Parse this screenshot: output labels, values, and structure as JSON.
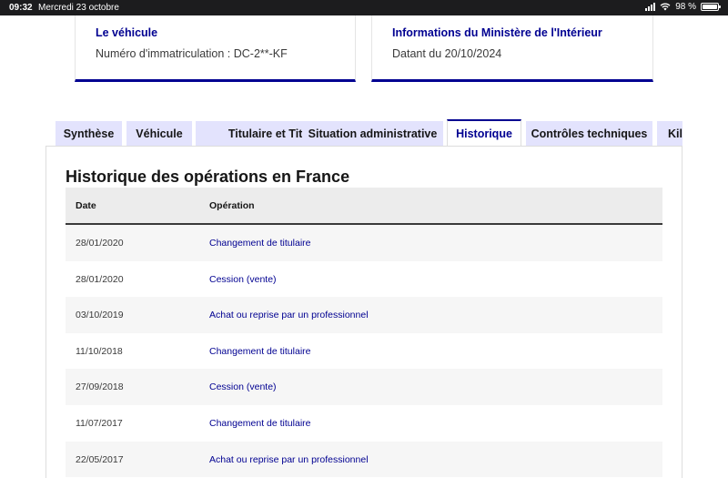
{
  "statusbar": {
    "time": "09:32",
    "date": "Mercredi 23 octobre",
    "battery": "98 %",
    "battery_level_percent": 98
  },
  "cards": {
    "vehicle": {
      "title": "Le véhicule",
      "text": "Numéro d'immatriculation : DC-2**-KF"
    },
    "ministry": {
      "title": "Informations du Ministère de l'Intérieur",
      "text": "Datant du 20/10/2024"
    }
  },
  "tabs": [
    {
      "label": "Synthèse"
    },
    {
      "label": "Véhicule"
    },
    {
      "label": "Titulaire et Titre"
    },
    {
      "label": "Situation administrative"
    },
    {
      "label": "Historique"
    },
    {
      "label": "Contrôles techniques"
    },
    {
      "label": "Kilométrage"
    }
  ],
  "active_tab": "Historique",
  "history": {
    "title": "Historique des opérations en France",
    "columns": {
      "date": "Date",
      "operation": "Opération"
    },
    "rows": [
      {
        "date": "28/01/2020",
        "operation": "Changement de titulaire"
      },
      {
        "date": "28/01/2020",
        "operation": "Cession (vente)"
      },
      {
        "date": "03/10/2019",
        "operation": "Achat ou reprise par un professionnel"
      },
      {
        "date": "11/10/2018",
        "operation": "Changement de titulaire"
      },
      {
        "date": "27/09/2018",
        "operation": "Cession (vente)"
      },
      {
        "date": "11/07/2017",
        "operation": "Changement de titulaire"
      },
      {
        "date": "22/05/2017",
        "operation": "Achat ou reprise par un professionnel"
      }
    ]
  },
  "colors": {
    "accent": "#000091",
    "tab_background": "#e3e3fd",
    "header_background": "#ececec",
    "row_alt_background": "#f6f6f6"
  }
}
